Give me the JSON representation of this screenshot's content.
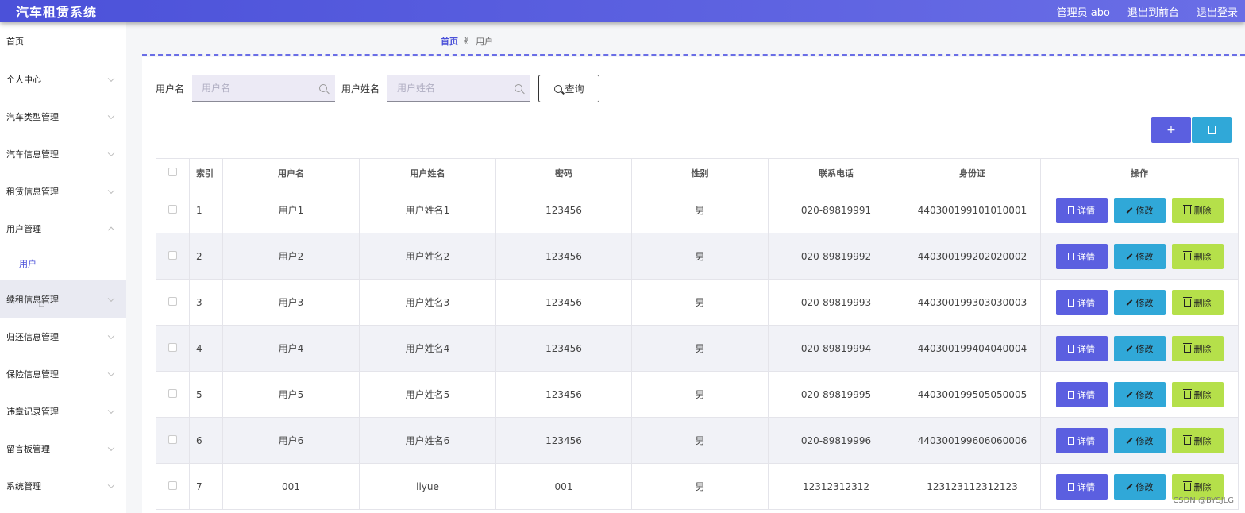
{
  "topbar": {
    "title": "汽车租赁系统",
    "admin": "管理员 abo",
    "front": "退出到前台",
    "logout": "退出登录"
  },
  "sidebar": {
    "home": "首页",
    "items": [
      "个人中心",
      "汽车类型管理",
      "汽车信息管理",
      "租赁信息管理",
      "用户管理"
    ],
    "sub": "用户",
    "items2": [
      "续租信息管理",
      "归还信息管理",
      "保险信息管理",
      "违章记录管理",
      "留言板管理",
      "系统管理"
    ]
  },
  "breadcrumb": {
    "home": "首页",
    "current": "用户"
  },
  "search": {
    "username_label": "用户名",
    "username_placeholder": "用户名",
    "name_label": "用户姓名",
    "name_placeholder": "用户姓名",
    "query_label": "查询"
  },
  "toolbar": {
    "add_label": "+"
  },
  "table": {
    "columns": [
      "索引",
      "用户名",
      "用户姓名",
      "密码",
      "性别",
      "联系电话",
      "身份证",
      "操作"
    ],
    "rows": [
      [
        "1",
        "用户1",
        "用户姓名1",
        "123456",
        "男",
        "020-89819991",
        "440300199101010001"
      ],
      [
        "2",
        "用户2",
        "用户姓名2",
        "123456",
        "男",
        "020-89819992",
        "440300199202020002"
      ],
      [
        "3",
        "用户3",
        "用户姓名3",
        "123456",
        "男",
        "020-89819993",
        "440300199303030003"
      ],
      [
        "4",
        "用户4",
        "用户姓名4",
        "123456",
        "男",
        "020-89819994",
        "440300199404040004"
      ],
      [
        "5",
        "用户5",
        "用户姓名5",
        "123456",
        "男",
        "020-89819995",
        "440300199505050005"
      ],
      [
        "6",
        "用户6",
        "用户姓名6",
        "123456",
        "男",
        "020-89819996",
        "440300199606060006"
      ],
      [
        "7",
        "001",
        "liyue",
        "001",
        "男",
        "12312312312",
        "123123112312123"
      ]
    ],
    "actions": {
      "detail": "详情",
      "edit": "修改",
      "delete": "删除"
    }
  },
  "watermark": "CSDN @BYSJLG",
  "colors": {
    "primary": "#5b5fe0",
    "edit": "#30a8d8",
    "delete": "#b5e04a"
  }
}
